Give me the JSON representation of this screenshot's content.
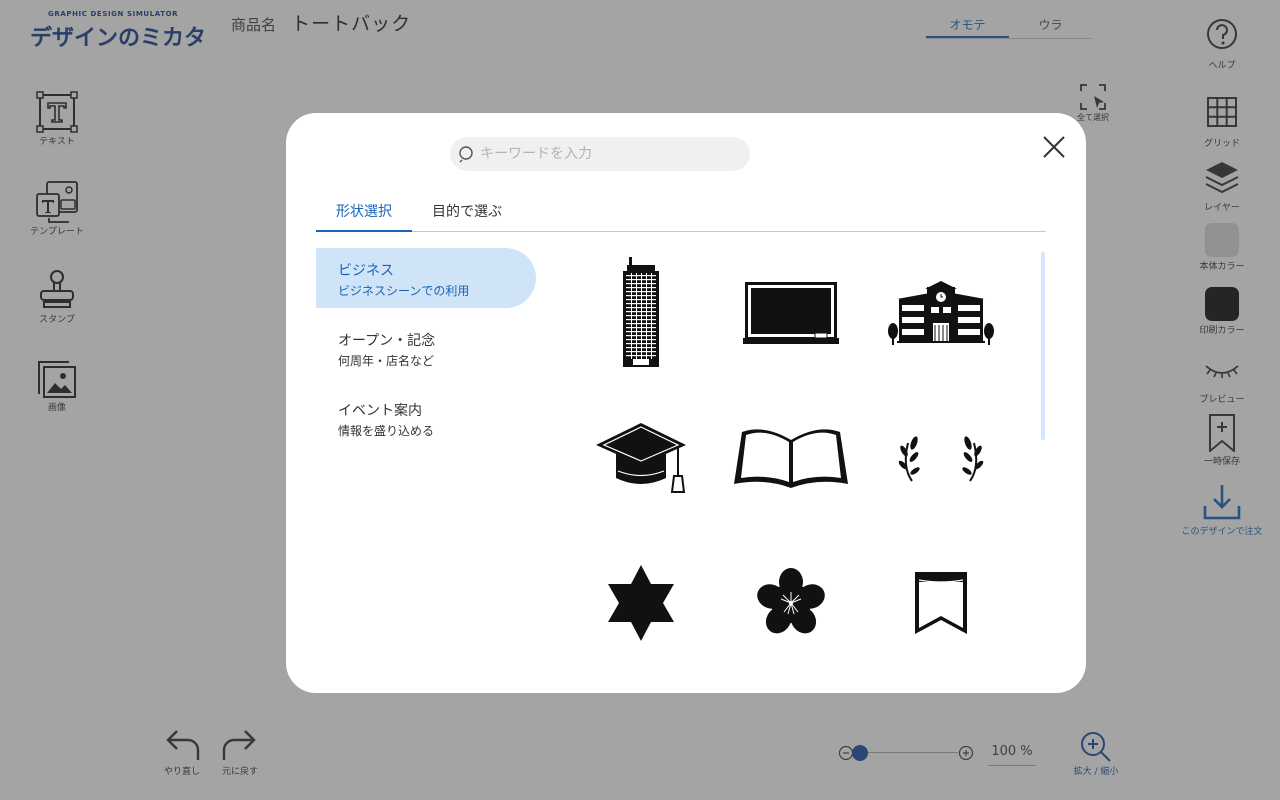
{
  "app": {
    "logo_sub": "GRAPHIC DESIGN SIMULATOR",
    "logo_main": "デザインのミカタ",
    "product_label": "商品名",
    "product_name": "トートバック",
    "sides": [
      "オモテ",
      "ウラ"
    ],
    "active_side": "オモテ"
  },
  "left_tools": [
    {
      "label": "テキスト",
      "icon": "text-icon"
    },
    {
      "label": "テンプレート",
      "icon": "template-icon"
    },
    {
      "label": "スタンプ",
      "icon": "stamp-icon"
    },
    {
      "label": "画像",
      "icon": "image-icon"
    }
  ],
  "right_tools": {
    "help": "ヘルプ",
    "grid": "グリッド",
    "layer": "レイヤー",
    "body_color": "本体カラー",
    "body_color_value": "#d9d9d6",
    "print_color": "印刷カラー",
    "print_color_value": "#111111",
    "preview": "プレビュー",
    "save": "一時保存",
    "order": "このデザインで注文"
  },
  "select_all": "全て選択",
  "undo": "やり直し",
  "redo": "元に戻す",
  "zoom_value": "100 %",
  "zoom_button": "拡大 / 縮小",
  "accent_color": "#1a63b8",
  "modal": {
    "search_placeholder": "キーワードを入力",
    "tabs": [
      "形状選択",
      "目的で選ぶ"
    ],
    "active_tab": "形状選択",
    "categories": [
      {
        "title": "ビジネス",
        "subtitle": "ビジネスシーンでの利用",
        "active": true
      },
      {
        "title": "オープン・記念",
        "subtitle": "何周年・店名など",
        "active": false
      },
      {
        "title": "イベント案内",
        "subtitle": "情報を盛り込める",
        "active": false
      }
    ],
    "stamps": [
      "building-icon",
      "blackboard-icon",
      "school-icon",
      "graduation-cap-icon",
      "open-book-icon",
      "laurel-icon",
      "star-of-david-icon",
      "cherry-blossom-icon",
      "bookmark-icon"
    ]
  }
}
